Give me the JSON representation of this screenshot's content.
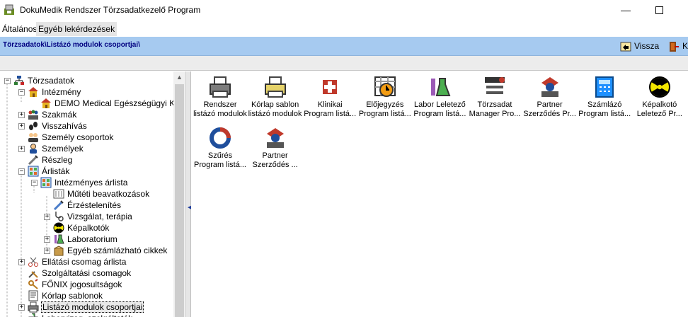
{
  "window": {
    "title": "DokuMedik Rendszer Törzsadatkezelő Program"
  },
  "menu": [
    {
      "label": "Általános"
    },
    {
      "label": "Egyéb lekérdezések"
    }
  ],
  "path": {
    "text": "Törzsadatok\\Listázó modulok csoportjai\\"
  },
  "toolbar": {
    "back_label": "Vissza",
    "close_label": "K"
  },
  "tree": [
    {
      "label": "Törzsadatok",
      "level": 0,
      "icon": "sitemap-icon",
      "expander": "-"
    },
    {
      "label": "Intézmény",
      "level": 1,
      "icon": "institution-house-icon",
      "expander": "-"
    },
    {
      "label": "DEMO Medical Egészségügyi Kft.",
      "level": 2,
      "icon": "institution-house-icon",
      "expander": ""
    },
    {
      "label": "Szakmák",
      "level": 1,
      "icon": "people-group-icon",
      "expander": "+"
    },
    {
      "label": "Visszahívás",
      "level": 1,
      "icon": "recall-footprints-icon",
      "expander": "+"
    },
    {
      "label": "Személy csoportok",
      "level": 1,
      "icon": "person-group-icon",
      "expander": ""
    },
    {
      "label": "Személyek",
      "level": 1,
      "icon": "person-icon",
      "expander": "+"
    },
    {
      "label": "Részleg",
      "level": 1,
      "icon": "syringe-icon",
      "expander": ""
    },
    {
      "label": "Árlisták",
      "level": 1,
      "icon": "calculator-grid-icon",
      "expander": "-"
    },
    {
      "label": "Intézményes árlista",
      "level": 2,
      "icon": "calculator-grid-icon",
      "expander": "-"
    },
    {
      "label": "Műtéti beavatkozások",
      "level": 3,
      "icon": "surgery-tools-icon",
      "expander": ""
    },
    {
      "label": "Érzéstelenítés",
      "level": 3,
      "icon": "anesthesia-syringe-icon",
      "expander": ""
    },
    {
      "label": "Vizsgálat, terápia",
      "level": 3,
      "icon": "stethoscope-icon",
      "expander": "+"
    },
    {
      "label": "Képalkotók",
      "level": 3,
      "icon": "radiation-icon",
      "expander": ""
    },
    {
      "label": "Laboratorium",
      "level": 3,
      "icon": "lab-flask-icon",
      "expander": "+"
    },
    {
      "label": "Egyéb számlázható cikkek",
      "level": 3,
      "icon": "package-box-icon",
      "expander": "+"
    },
    {
      "label": "Ellátási csomag árlista",
      "level": 1,
      "icon": "scissors-icon",
      "expander": "+"
    },
    {
      "label": "Szolgáltatási csomagok",
      "level": 1,
      "icon": "tools-icon",
      "expander": ""
    },
    {
      "label": "FŐNIX jogosultságok",
      "level": 1,
      "icon": "phoenix-key-icon",
      "expander": ""
    },
    {
      "label": "Kórlap sablonok",
      "level": 1,
      "icon": "form-template-icon",
      "expander": ""
    },
    {
      "label": "Listázó modulok csoportjai",
      "level": 1,
      "icon": "printer-icon",
      "expander": "+",
      "selected": true
    },
    {
      "label": "Laborvizsg. szolgáltatók",
      "level": 1,
      "icon": "lab-provider-icon",
      "expander": ""
    }
  ],
  "modules": [
    {
      "line1": "Rendszer",
      "line2": "listázó modulok",
      "icon": "printer-icon"
    },
    {
      "line1": "Kórlap sablon",
      "line2": "listázó modulok",
      "icon": "printer-yellow-icon"
    },
    {
      "line1": "Klinikai",
      "line2": "Program listá...",
      "icon": "clinic-cross-icon"
    },
    {
      "line1": "Előjegyzés",
      "line2": "Program listá...",
      "icon": "calendar-clock-icon"
    },
    {
      "line1": "Labor Leletező",
      "line2": "Program listá...",
      "icon": "lab-flask-icon"
    },
    {
      "line1": "Törzsadat",
      "line2": "Manager Pro...",
      "icon": "master-data-tools-icon"
    },
    {
      "line1": "Partner",
      "line2": "Szerződés Pr...",
      "icon": "partner-contract-icon"
    },
    {
      "line1": "Számlázó",
      "line2": "Program listá...",
      "icon": "calculator-icon"
    },
    {
      "line1": "Képalkotó",
      "line2": "Leletező Pr...",
      "icon": "radiation-icon"
    },
    {
      "line1": "Szűrés",
      "line2": "Program listá...",
      "icon": "screening-cycle-icon"
    },
    {
      "line1": "Partner",
      "line2": "Szerződés ...",
      "icon": "partner-contract-icon"
    }
  ]
}
